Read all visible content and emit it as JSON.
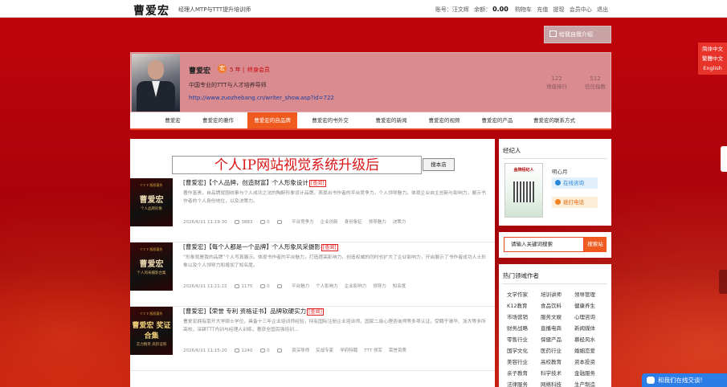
{
  "header": {
    "logo": "曹爱宏",
    "slogan": "经理人MTP与TTT提升培训师",
    "account_label": "账号：",
    "account_name": "汪文辉",
    "balance_label": "余额：",
    "balance": "0.00",
    "links": [
      "购物车",
      "充值",
      "提现",
      "会员中心",
      "退出"
    ]
  },
  "message_button": "给我自我介绍",
  "language": [
    "简体中文",
    "繁體中文",
    "English"
  ],
  "profile": {
    "name": "曹爱宏",
    "badge": "宏",
    "years": "5 年 |",
    "member": "终身会员",
    "tagline": "中国专业的TTT与人才培养导师",
    "url": "http://www.zuozhebang.cn/writer_show.asp?id=722",
    "stats": [
      {
        "value": "122",
        "label": "增值排行"
      },
      {
        "value": "512",
        "label": "信任指数"
      }
    ]
  },
  "nav": {
    "items": [
      "曹爱宏",
      "曹爱宏的著作",
      "曹爱宏的自品牌",
      "曹爱宏的书外交",
      "曹爱宏的新闻",
      "曹爱宏的视频",
      "曹爱宏的产品",
      "曹爱宏的联系方式"
    ],
    "active": 2
  },
  "banner": "个人IP网站视觉系统升级后",
  "banner_button": "搜本店",
  "articles": [
    {
      "title": "[曹爱宏]【个人品牌，创造财富】个人形象设计",
      "rec": "[查阅]",
      "desc": "著作富贵。自品牌就围绕事与个人成功之法的陶醉形象设计品牌。表现出书作者的平台竞争力，个人领导魅力。体现企业自主创新与影响力，展示书作者的个人身份地位，以及决策力。",
      "date": "2026/6/11 11:19:30",
      "views": "3883",
      "comments": "0",
      "tags": [
        "平台竞争力",
        "企业创新",
        "身份象征",
        "领导魅力",
        "决策力"
      ],
      "thumb": {
        "top": "T T T 版权著作",
        "big": "曹爱宏",
        "sm": "个人品牌形象"
      }
    },
    {
      "title": "[曹爱宏]【每个人都是一个品牌】个人形象风采摄影",
      "rec": "[查阅]",
      "desc": "“形象就是我的品牌”个人写真展示。体现书作者的平台魅力，打造提高影响力，创造权威的同时也扩大了企业影响力，开启展示了书作者成功人士形象以及个人领导力和增加了知名度。",
      "date": "2026/6/11 11:21:22",
      "views": "1175",
      "comments": "0",
      "tags": [
        "平台魅力",
        "个人影响力",
        "企业影响力",
        "领导力",
        "知名度"
      ],
      "thumb": {
        "top": "T T T 版权著作",
        "big": "曹爱宏",
        "sm": "个人风采摄影合集"
      }
    },
    {
      "title": "[曹爱宏]【荣誉 专利 资格证书】品牌软硬实力",
      "rec": "[查阅]",
      "desc": "曹爱宏拥有南开大学硕士学位，具备十三年企业培训师经验，持有国际注册企业培训师、国家二级心理咨询师等多项认证。受聘于清华、浙大等多所高校，深耕TTT内训与经理人训练，著获全国百强培训…",
      "date": "2026/6/11 11:15:20",
      "views": "1240",
      "comments": "0",
      "tags": [
        "资深导师",
        "实战专家",
        "学府特聘",
        "TTT 领军",
        "荣誉资质"
      ],
      "thumb": {
        "top": "T T T 版权著作",
        "big": "曹爱宏 奖证合集",
        "sm": "实力精英 高阶证照"
      }
    }
  ],
  "agent": {
    "title": "经纪人",
    "card_header": "金牌经纪人",
    "name": "明心月",
    "consult": "在线咨询",
    "call": "拨打电话"
  },
  "search": {
    "placeholder": "请输入关键词搜索",
    "button": "搜索站"
  },
  "hot": {
    "title": "热门领域作者",
    "tags": [
      "文学作家",
      "培训讲师",
      "领导管理",
      "K12教育",
      "食品饮料",
      "健康养生",
      "市场营销",
      "服务文娱",
      "心理咨询",
      "财务战略",
      "直播电商",
      "新闻媒体",
      "零售行业",
      "保健产品",
      "慕经风水",
      "国学文化",
      "医药行业",
      "婚姻恋爱",
      "美容行业",
      "高校教育",
      "资本投资",
      "亲子教育",
      "科学技术",
      "金融服务",
      "法律服务",
      "网络科技",
      "生产制造"
    ]
  },
  "chat": "和我们在线交谈!"
}
